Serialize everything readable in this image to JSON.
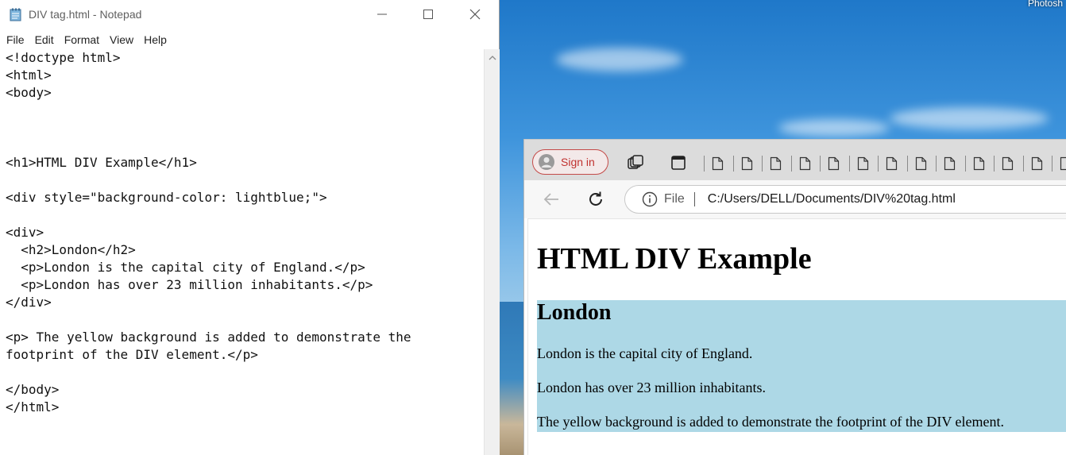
{
  "desktop": {
    "corner_label": "Photosh"
  },
  "notepad": {
    "title": "DIV tag.html - Notepad",
    "menu": [
      "File",
      "Edit",
      "Format",
      "View",
      "Help"
    ],
    "code": "<!doctype html>\n<html>\n<body>\n\n\n\n<h1>HTML DIV Example</h1>\n\n<div style=\"background-color: lightblue;\">\n\n<div>\n  <h2>London</h2>\n  <p>London is the capital city of England.</p>\n  <p>London has over 23 million inhabitants.</p>\n</div>\n\n<p> The yellow background is added to demonstrate the\nfootprint of the DIV element.</p>\n\n</body>\n</html>"
  },
  "browser": {
    "sign_in_label": "Sign in",
    "address": {
      "scheme_label": "File",
      "url": "C:/Users/DELL/Documents/DIV%20tag.html"
    },
    "page": {
      "h1": "HTML DIV Example",
      "div_background": "#add8e6",
      "h2": "London",
      "paragraphs": [
        "London is the capital city of England.",
        "London has over 23 million inhabitants.",
        "The yellow background is added to demonstrate the footprint of the DIV element."
      ]
    }
  },
  "colors": {
    "signin_accent": "#c44a48",
    "div_lightblue": "#add8e6"
  }
}
